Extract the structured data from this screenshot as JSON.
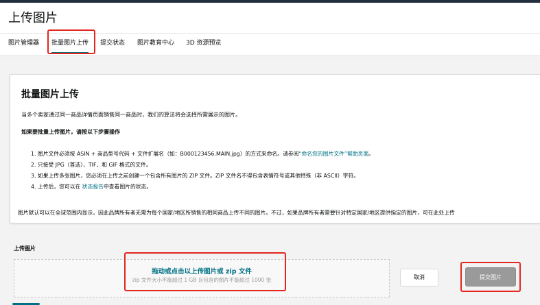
{
  "page": {
    "title": "上传图片"
  },
  "tabs": [
    {
      "label": "图片管理器"
    },
    {
      "label": "批量图片上传"
    },
    {
      "label": "提交状态"
    },
    {
      "label": "图片教育中心"
    },
    {
      "label": "3D 资源预览"
    }
  ],
  "card": {
    "title": "批量图片上传",
    "intro": "当多个卖家通过同一商品详情页面销售同一商品时，我们的算法将会选择所需展示的图片。",
    "steps_heading": "如果要批量上传图片，请按以下步骤操作",
    "step1_pre": "1. 图片文件必须按 ASIN + 商品型号代码 + 文件扩展名（如：B000123456.MAIN.jpg）的方式来命名。请参阅",
    "step1_link": "“命名您的图片文件”帮助页面",
    "step1_post": "。",
    "step2": "2. 只接受 JPG（首选）、TIF、和 GIF 格式的文件。",
    "step3": "3. 如果上传多张图片，您必须在上传之前创建一个包含所有图片的 ZIP 文件。ZIP 文件名不得包含表情符号或其他特殊（非 ASCII）字符。",
    "step4_pre": "4. 上传后，您可以在 ",
    "step4_link": "状态报告",
    "step4_post": "中查看图片的状态。",
    "footer_note": "图片默认可以在全球范围内显示，因此品牌所有者无需为每个国家/地区所销售的相同商品上传不同的图片。不过，如果品牌所有者需要针对特定国家/地区提供指定的图片，可在此处上传"
  },
  "upload": {
    "heading": "上传图片",
    "drop_main": "拖动或点击以上传图片或 zip 文件",
    "drop_sub": "zip 文件大小不能超过 1 GB 且包含的图片不能超过 1000 张",
    "cancel_label": "取消",
    "submit_label": "提交图片"
  },
  "colors": {
    "highlight": "#e3261c",
    "link": "#007185",
    "submit_disabled": "#9a9a9a"
  }
}
